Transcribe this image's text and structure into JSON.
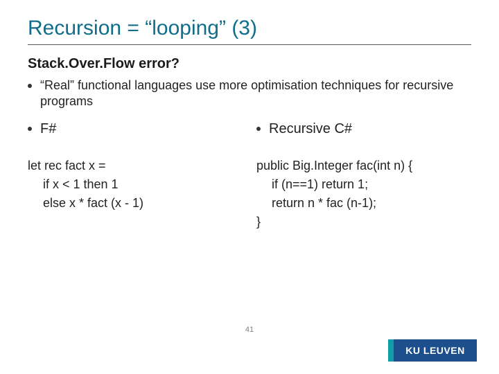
{
  "title": "Recursion = “looping” (3)",
  "subheading": "Stack.Over.Flow error?",
  "bullet1": "“Real” functional languages use more optimisation techniques for recursive programs",
  "left": {
    "lang": "F#",
    "code": {
      "l1": "let rec fact x =",
      "l2": "if x < 1 then 1",
      "l3": "else x * fact (x - 1)"
    }
  },
  "right": {
    "lang": "Recursive C#",
    "code": {
      "l1": "public Big.Integer fac(int n) {",
      "l2": "if (n==1) return 1;",
      "l3": "return n * fac (n-1);",
      "l4": "}"
    }
  },
  "page_number": "41",
  "brand": "KU LEUVEN"
}
